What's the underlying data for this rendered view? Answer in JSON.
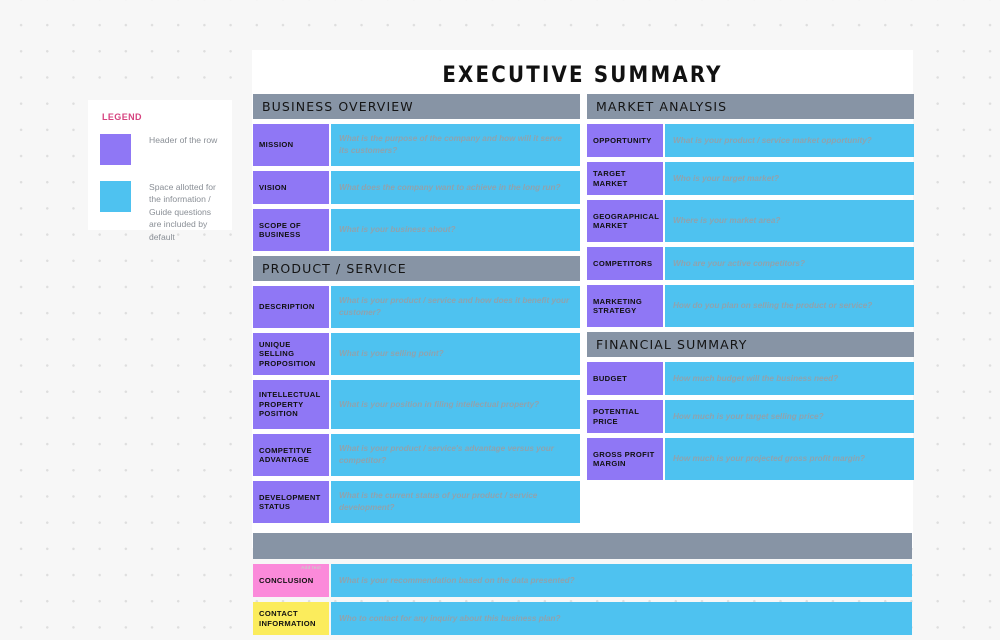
{
  "legend": {
    "title": "LEGEND",
    "items": [
      {
        "swatch": "purple",
        "text": "Header of the row"
      },
      {
        "swatch": "cyan",
        "text": "Space allotted for the information / Guide questions are included by default"
      }
    ]
  },
  "board": {
    "title": "EXECUTIVE SUMMARY",
    "left_column": [
      {
        "section": "BUSINESS OVERVIEW",
        "rows": [
          {
            "label": "MISSION",
            "answer": "What is the purpose of the company and how will it serve its customers?",
            "size": "h2"
          },
          {
            "label": "VISION",
            "answer": "What does the company want to achieve in the long run?",
            "size": "h1"
          },
          {
            "label": "SCOPE OF BUSINESS",
            "answer": "What is your business about?",
            "size": "h2"
          }
        ]
      },
      {
        "section": "PRODUCT / SERVICE",
        "rows": [
          {
            "label": "DESCRIPTION",
            "answer": "What is your product / service and how does it benefit your customer?",
            "size": "h2"
          },
          {
            "label": "UNIQUE SELLING PROPOSITION",
            "answer": "What is your selling point?",
            "size": "h2"
          },
          {
            "label": "INTELLECTUAL PROPERTY POSITION",
            "answer": "What is your position in filing intellectual property?",
            "size": "h3"
          },
          {
            "label": "COMPETITVE ADVANTAGE",
            "answer": "What is your product / service's advantage versus your competitor?",
            "size": "h2"
          },
          {
            "label": "DEVELOPMENT STATUS",
            "answer": "What is the current status of your product / service development?",
            "size": "h2"
          }
        ]
      }
    ],
    "right_column": [
      {
        "section": "MARKET ANALYSIS",
        "rows": [
          {
            "label": "OPPORTUNITY",
            "answer": "What is your product / service market opportunity?",
            "size": "h1"
          },
          {
            "label": "TARGET MARKET",
            "answer": "Who is your target market?",
            "size": "h1"
          },
          {
            "label": "GEOGRAPHICAL MARKET",
            "answer": "Where is your market area?",
            "size": "h2"
          },
          {
            "label": "COMPETITORS",
            "answer": "Who are your active competitors?",
            "size": "h1"
          },
          {
            "label": "MARKETING STRATEGY",
            "answer": "How do you plan on selling the product or service?",
            "size": "h2"
          }
        ]
      },
      {
        "section": "FINANCIAL SUMMARY",
        "rows": [
          {
            "label": "BUDGET",
            "answer": "How much budget will the business need?",
            "size": "h1"
          },
          {
            "label": "POTENTIAL PRICE",
            "answer": "How much is your target selling price?",
            "size": "h1"
          },
          {
            "label": "GROSS PROFIT MARGIN",
            "answer": "How much is your projected gross profit margin?",
            "size": "h2"
          }
        ]
      }
    ],
    "bottom_rows": [
      {
        "label": "CONCLUSION",
        "answer": "What is your recommendation based on the data presented?",
        "color": "pink",
        "tip": "Add text"
      },
      {
        "label": "CONTACT INFORMATION",
        "answer": "Who to contact for any inquiry about this business plan?",
        "color": "yellow",
        "tip": ""
      }
    ]
  },
  "colors": {
    "header_gray": "#8794A5",
    "label_purple": "#8F77F5",
    "answer_cyan": "#4EC2F0",
    "conclusion_pink": "#FB8ADA",
    "contact_yellow": "#FBEC5C",
    "legend_title_pink": "#D6437F",
    "canvas_bg": "#F7F7F7"
  }
}
